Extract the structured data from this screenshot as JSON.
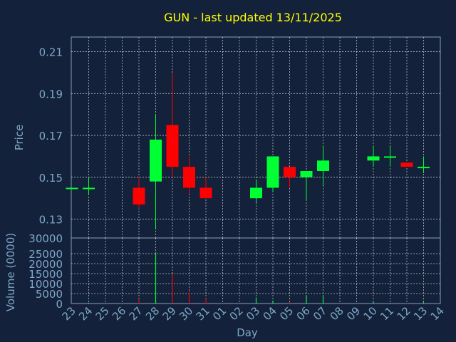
{
  "chart_data": {
    "type": "candlestick",
    "title": "GUN - last updated 13/11/2025",
    "xlabel": "Day",
    "price_panel": {
      "ylabel": "Price",
      "ylim": [
        0.121,
        0.217
      ],
      "yticks": [
        0.13,
        0.15,
        0.17,
        0.19,
        0.21
      ],
      "ytick_labels": [
        "0.13",
        "0.15",
        "0.17",
        "0.19",
        "0.21"
      ],
      "grid": true
    },
    "volume_panel": {
      "ylabel": "Volume (0000)",
      "ylim": [
        0,
        30000
      ],
      "yticks": [
        0,
        5000,
        10000,
        15000,
        20000,
        25000,
        30000
      ],
      "ytick_labels": [
        "0",
        "5000",
        "10000",
        "15000",
        "20000",
        "25000",
        "30000"
      ],
      "grid": true
    },
    "categories": [
      "23",
      "24",
      "25",
      "26",
      "27",
      "28",
      "29",
      "30",
      "31",
      "01",
      "02",
      "03",
      "04",
      "05",
      "06",
      "07",
      "08",
      "09",
      "10",
      "11",
      "12",
      "13",
      "14"
    ],
    "candles": [
      {
        "day": "23",
        "open": 0.145,
        "close": 0.145,
        "high": 0.145,
        "low": 0.145,
        "volume": 0
      },
      {
        "day": "24",
        "open": 0.145,
        "close": 0.145,
        "high": 0.15,
        "low": 0.142,
        "volume": 400
      },
      {
        "day": "27",
        "open": 0.145,
        "close": 0.137,
        "high": 0.15,
        "low": 0.135,
        "volume": 2000
      },
      {
        "day": "28",
        "open": 0.148,
        "close": 0.168,
        "high": 0.18,
        "low": 0.125,
        "volume": 25000
      },
      {
        "day": "29",
        "open": 0.175,
        "close": 0.155,
        "high": 0.2,
        "low": 0.15,
        "volume": 15000
      },
      {
        "day": "30",
        "open": 0.155,
        "close": 0.145,
        "high": 0.16,
        "low": 0.142,
        "volume": 6000
      },
      {
        "day": "31",
        "open": 0.145,
        "close": 0.14,
        "high": 0.15,
        "low": 0.14,
        "volume": 2500
      },
      {
        "day": "03",
        "open": 0.14,
        "close": 0.145,
        "high": 0.149,
        "low": 0.138,
        "volume": 3000
      },
      {
        "day": "04",
        "open": 0.145,
        "close": 0.16,
        "high": 0.16,
        "low": 0.143,
        "volume": 1500
      },
      {
        "day": "05",
        "open": 0.155,
        "close": 0.15,
        "high": 0.155,
        "low": 0.145,
        "volume": 800
      },
      {
        "day": "06",
        "open": 0.15,
        "close": 0.153,
        "high": 0.153,
        "low": 0.139,
        "volume": 4000
      },
      {
        "day": "07",
        "open": 0.153,
        "close": 0.158,
        "high": 0.165,
        "low": 0.146,
        "volume": 4000
      },
      {
        "day": "10",
        "open": 0.158,
        "close": 0.16,
        "high": 0.165,
        "low": 0.155,
        "volume": 800
      },
      {
        "day": "11",
        "open": 0.16,
        "close": 0.16,
        "high": 0.165,
        "low": 0.155,
        "volume": 300
      },
      {
        "day": "12",
        "open": 0.157,
        "close": 0.155,
        "high": 0.157,
        "low": 0.155,
        "volume": 300
      },
      {
        "day": "13",
        "open": 0.155,
        "close": 0.155,
        "high": 0.16,
        "low": 0.152,
        "volume": 700
      }
    ],
    "colors": {
      "background": "#13213a",
      "up": "#00ff33",
      "down": "#ff0000",
      "title": "#ffff00",
      "axis_text": "#7fa7c8",
      "grid": "#ffffff",
      "axis_label": "#7fa7c8"
    }
  }
}
